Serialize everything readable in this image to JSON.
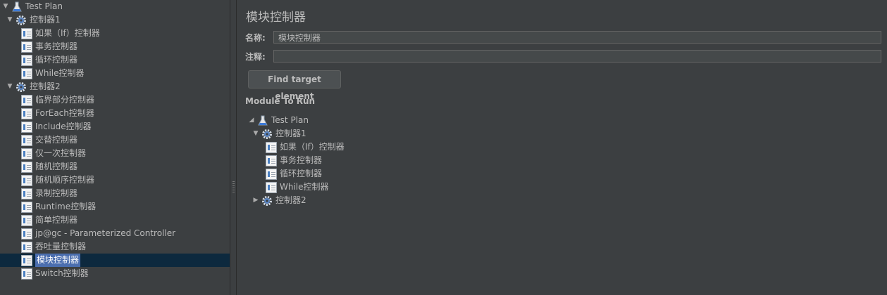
{
  "left_tree": {
    "root": {
      "label": "Test Plan",
      "icon": "flask-icon"
    },
    "groups": [
      {
        "label": "控制器1",
        "icon": "gear-icon",
        "expanded": true,
        "items": [
          "如果（If）控制器",
          "事务控制器",
          "循环控制器",
          "While控制器"
        ]
      },
      {
        "label": "控制器2",
        "icon": "gear-icon",
        "expanded": true,
        "items": [
          "临界部分控制器",
          "ForEach控制器",
          "Include控制器",
          "交替控制器",
          "仅一次控制器",
          "随机控制器",
          "随机顺序控制器",
          "录制控制器",
          "Runtime控制器",
          "简单控制器",
          "jp@gc - Parameterized Controller",
          "吞吐量控制器",
          "模块控制器",
          "Switch控制器"
        ]
      }
    ],
    "selected": "模块控制器"
  },
  "panel": {
    "title": "模块控制器",
    "name_label": "名称:",
    "name_value": "模块控制器",
    "comment_label": "注释:",
    "comment_value": "",
    "find_button": "Find target element",
    "module_to_run_label": "Module To Run"
  },
  "module_tree": {
    "root": "Test Plan",
    "group1": {
      "label": "控制器1",
      "items": [
        "如果（If）控制器",
        "事务控制器",
        "循环控制器",
        "While控制器"
      ]
    },
    "group2": {
      "label": "控制器2",
      "collapsed": true
    }
  },
  "colors": {
    "background": "#3c3f41",
    "selection": "#4b6eaf",
    "selected_row": "#0d293e"
  }
}
